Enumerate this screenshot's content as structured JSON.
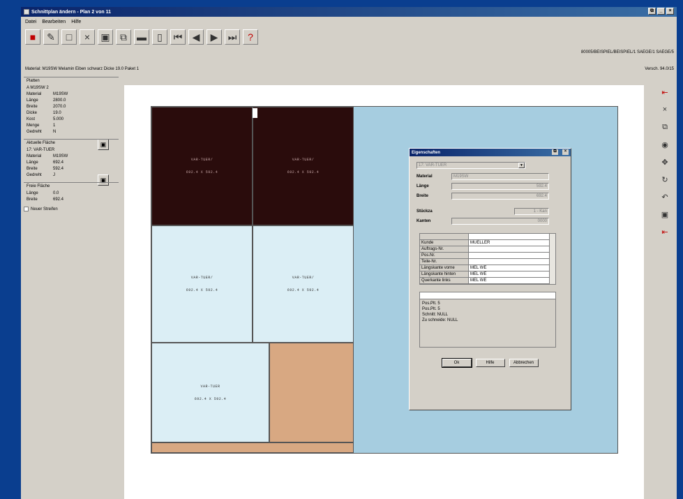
{
  "window": {
    "title": "Schnittplan ändern - Plan 2 von 11",
    "controls": [
      "⧉",
      "_",
      "×"
    ]
  },
  "menu": [
    "Datei",
    "Bearbeiten",
    "Hilfe"
  ],
  "toolbar": {
    "icons": [
      "save-icon",
      "tools-icon",
      "new-icon",
      "delete-icon",
      "grid-icon",
      "copy-icon",
      "stack-icon",
      "page-icon",
      "first-icon",
      "prev-icon",
      "next-icon",
      "last-icon",
      "help-icon"
    ],
    "glyphs": [
      "■",
      "✎",
      "□",
      "×",
      "▣",
      "⧉",
      "▬",
      "▯",
      "⏮",
      "◀",
      "▶",
      "⏭",
      "?"
    ]
  },
  "path": "80005/BEISPIEL/BEISPIEL/1 SAEGE/1 SAEGE/5",
  "info_line": "Material: M19SW Melamin Eiben schwarz Dicke 19.0 Paket 1",
  "version": "Versch. 94.0/15",
  "left_panel": {
    "platten": {
      "title": "Platten",
      "header": "A M19SW 2",
      "rows": [
        {
          "k": "Material",
          "v": "M19SW"
        },
        {
          "k": "Länge",
          "v": "2800.0"
        },
        {
          "k": "Breite",
          "v": "2070.0"
        },
        {
          "k": "Dicke",
          "v": "19.0"
        },
        {
          "k": "Kost",
          "v": "5.000"
        },
        {
          "k": "Menge",
          "v": "1"
        },
        {
          "k": "Gedreht",
          "v": "N"
        }
      ]
    },
    "aktuelle": {
      "title": "Aktuelle Fläche",
      "header": "17: VAR-TUER",
      "rows": [
        {
          "k": "Material",
          "v": "M19SW"
        },
        {
          "k": "Länge",
          "v": "692.4"
        },
        {
          "k": "Breite",
          "v": "592.4"
        },
        {
          "k": "Gedreht",
          "v": "J"
        }
      ]
    },
    "freie": {
      "title": "Freie Fläche",
      "rows": [
        {
          "k": "Länge",
          "v": "0.0"
        },
        {
          "k": "Breite",
          "v": "692.4"
        }
      ]
    },
    "checkbox_label": "Neuer Streifen"
  },
  "board": {
    "pieces": [
      {
        "name": "VAR-TUER/",
        "dims": "692.4 X 592.4",
        "style": "dark"
      },
      {
        "name": "VAR-TUER/",
        "dims": "692.4 X 592.4",
        "style": "dark"
      },
      {
        "name": "VAR-TUER/",
        "dims": "692.4 X 592.4",
        "style": "light"
      },
      {
        "name": "VAR-TUER/",
        "dims": "692.4 X 592.4",
        "style": "light"
      },
      {
        "name": "VAR-TUER",
        "dims": "692.4 X 592.4",
        "style": "light"
      }
    ]
  },
  "dialog": {
    "title": "Eigenschaften",
    "combo": "17: VAR-TUER",
    "fields": [
      {
        "k": "Material",
        "v": "M19SW"
      },
      {
        "k": "Länge",
        "v": "592.4"
      },
      {
        "k": "Breite",
        "v": "692.4"
      }
    ],
    "stueckzahl": {
      "k": "Stückza",
      "v": "1 - Kan"
    },
    "kanten": {
      "k": "Kanten",
      "v": "0000"
    },
    "grid": [
      {
        "k": "Kunde",
        "v": "MUELLER"
      },
      {
        "k": "Auftrags-Nr.",
        "v": ""
      },
      {
        "k": "Pos.Nr.",
        "v": ""
      },
      {
        "k": "Teile-Nr.",
        "v": ""
      },
      {
        "k": "Längskante vorne",
        "v": "MEL WE"
      },
      {
        "k": "Längskante hinten",
        "v": "MEL WE"
      },
      {
        "k": "Querkante links",
        "v": "MEL WE"
      }
    ],
    "notes": [
      "Pos.Plt. 5",
      "Pos.Plt. 5",
      "Schnitt: NULL",
      "Zu schneide: NULL"
    ],
    "buttons": [
      "Ok",
      "Hilfe",
      "Abbrechen"
    ]
  },
  "right_toolbar": {
    "icons": [
      "insert-icon",
      "close-icon",
      "copy-icon",
      "settings-icon",
      "move-icon",
      "rotate-icon",
      "undo-icon",
      "page-icon",
      "insert-bottom-icon"
    ],
    "glyphs": [
      "⇤",
      "×",
      "⧉",
      "◉",
      "✥",
      "↻",
      "↶",
      "▣",
      "⇤"
    ]
  }
}
